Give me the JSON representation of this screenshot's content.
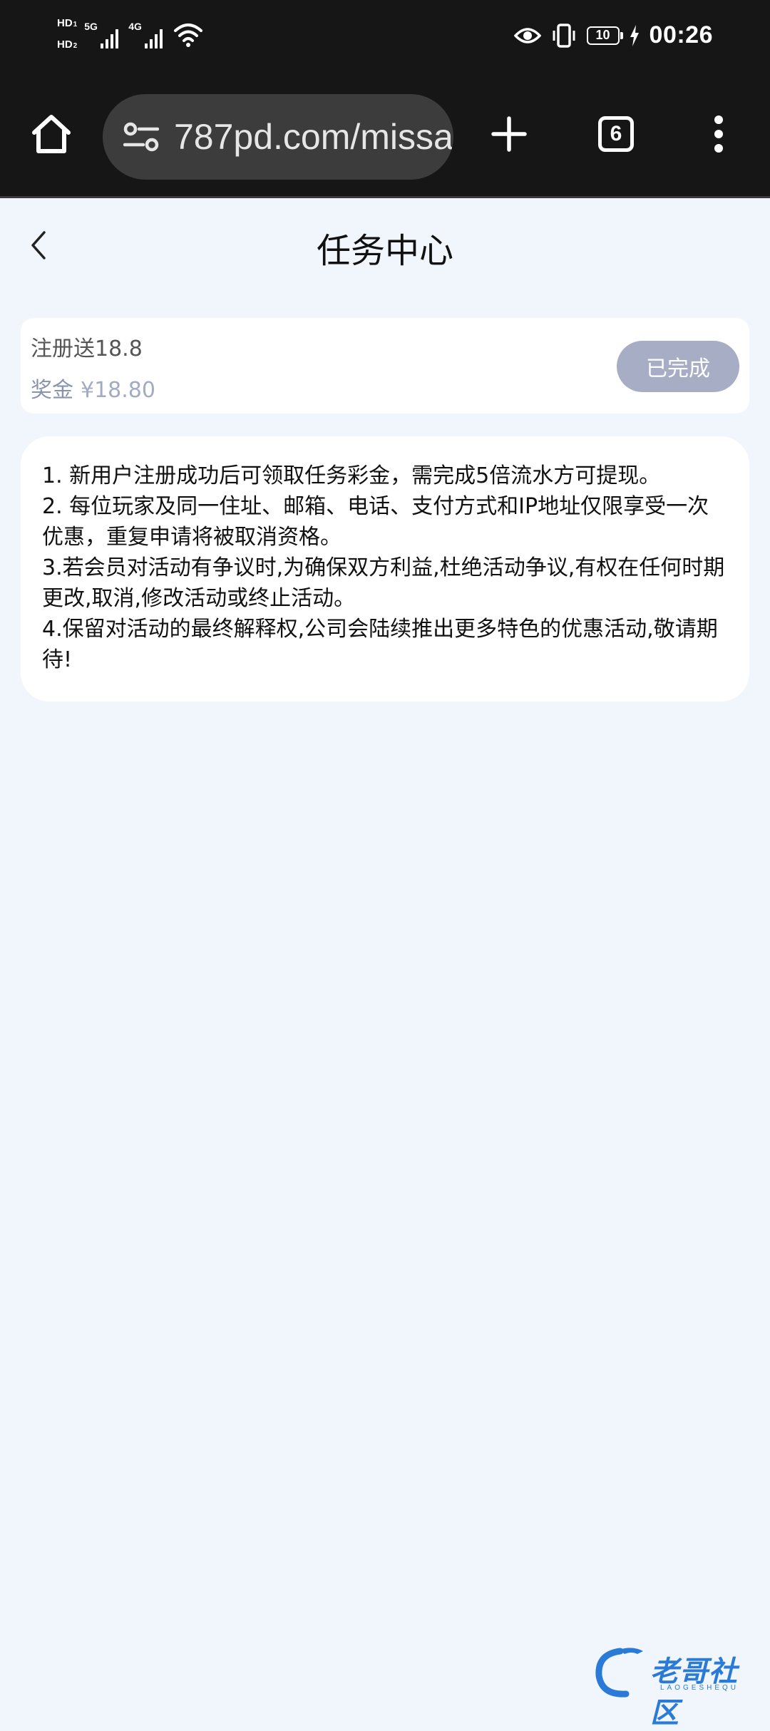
{
  "status_bar": {
    "sim1": "HD",
    "sim1_index": "1",
    "sim2": "HD",
    "sim2_index": "2",
    "net1": "5G",
    "net2": "4G",
    "battery_level": "10",
    "time": "00:26"
  },
  "browser": {
    "url": "787pd.com/missa",
    "tab_count": "6"
  },
  "page": {
    "title": "任务中心"
  },
  "task": {
    "name": "注册送18.8",
    "reward_label": "奖金",
    "reward_amount": "¥18.80",
    "status_label": "已完成"
  },
  "rules": [
    "1. 新用户注册成功后可领取任务彩金，需完成5倍流水方可提现。",
    "2. 每位玩家及同一住址、邮箱、电话、支付方式和IP地址仅限享受一次优惠，重复申请将被取消资格。",
    "3.若会员对活动有争议时,为确保双方利益,杜绝活动争议,有权在任何时期更改,取消,修改活动或终止活动。",
    "4.保留对活动的最终解释权,公司会陆续推出更多特色的优惠活动,敬请期待!"
  ],
  "watermark": {
    "text": "老哥社区",
    "sub": "LAOGESHEQU"
  },
  "colors": {
    "page_bg": "#f1f5fc",
    "chrome_bg": "#161616",
    "status_button": "#a7adc4",
    "reward_text": "#8a93ad",
    "watermark": "#2a7bd8"
  },
  "icons": {
    "home": "home-icon",
    "site_settings": "tune-icon",
    "new_tab": "plus-icon",
    "tabs": "tab-switcher-icon",
    "menu": "more-vert-icon",
    "back": "chevron-left-icon"
  }
}
